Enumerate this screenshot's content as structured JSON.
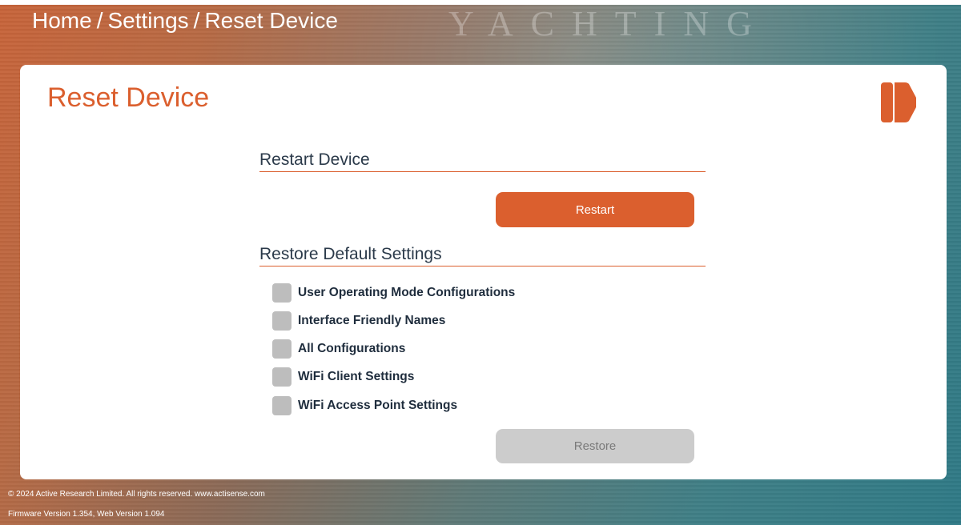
{
  "header": {
    "watermark": "YACHTING",
    "breadcrumb": {
      "home": "Home",
      "separator": "/",
      "settings": "Settings",
      "current": "Reset Device"
    }
  },
  "card": {
    "title": "Reset Device",
    "logo_icon": "k-logo-icon",
    "restart_section": {
      "title": "Restart Device",
      "button_label": "Restart"
    },
    "restore_section": {
      "title": "Restore Default Settings",
      "options": [
        {
          "label": "User Operating Mode Configurations",
          "checked": false
        },
        {
          "label": "Interface Friendly Names",
          "checked": false
        },
        {
          "label": "All Configurations",
          "checked": false
        },
        {
          "label": "WiFi Client Settings",
          "checked": false
        },
        {
          "label": "WiFi Access Point Settings",
          "checked": false
        }
      ],
      "button_label": "Restore"
    }
  },
  "footer": {
    "copyright": "© 2024 Active Research Limited. All rights reserved.  www.actisense.com",
    "versions": "Firmware Version 1.354, Web Version 1.094"
  },
  "colors": {
    "accent": "#db5f2e",
    "disabled": "#cccccc",
    "text_dark": "#1f2d3d"
  }
}
